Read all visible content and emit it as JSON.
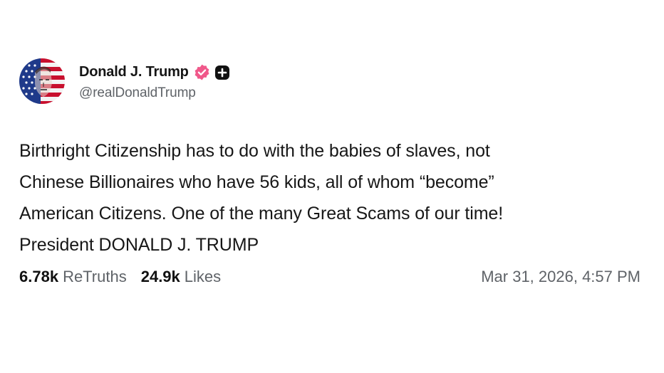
{
  "author": {
    "display_name": "Donald J. Trump",
    "handle": "@realDonaldTrump",
    "verified_badge_icon": "verified-check-icon",
    "verified_badge_color": "#f0588a",
    "plus_badge_icon": "plus-badge-icon"
  },
  "post": {
    "lines": [
      "Birthright Citizenship has to do with the babies of slaves, not",
      "Chinese Billionaires who have 56 kids, all of whom “become”",
      "American Citizens. One of the many Great Scams of our time!",
      "President DONALD J. TRUMP"
    ]
  },
  "stats": {
    "retruths_count": "6.78k",
    "retruths_label": "ReTruths",
    "likes_count": "24.9k",
    "likes_label": "Likes"
  },
  "timestamp": "Mar 31, 2026, 4:57 PM"
}
